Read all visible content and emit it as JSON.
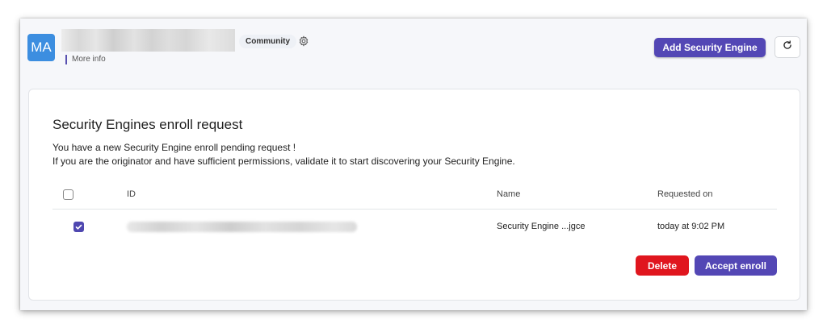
{
  "header": {
    "avatar_initials": "MA",
    "badge": "Community",
    "more_info": "More info",
    "add_button": "Add Security Engine",
    "icons": {
      "settings": "gear-icon",
      "refresh": "refresh-icon"
    }
  },
  "card": {
    "title": "Security Engines enroll request",
    "desc_line1": "You have a new Security Engine enroll pending request !",
    "desc_line2": "If you are the originator and have sufficient permissions, validate it to start discovering your Security Engine.",
    "table": {
      "headers": {
        "id": "ID",
        "name": "Name",
        "requested": "Requested on"
      },
      "rows": [
        {
          "selected": true,
          "name": "Security Engine ...jgce",
          "requested": "today at 9:02 PM"
        }
      ]
    },
    "delete_button": "Delete",
    "accept_button": "Accept enroll"
  },
  "colors": {
    "primary": "#5347b5",
    "danger": "#e0161e",
    "avatar": "#3c8ee0"
  }
}
